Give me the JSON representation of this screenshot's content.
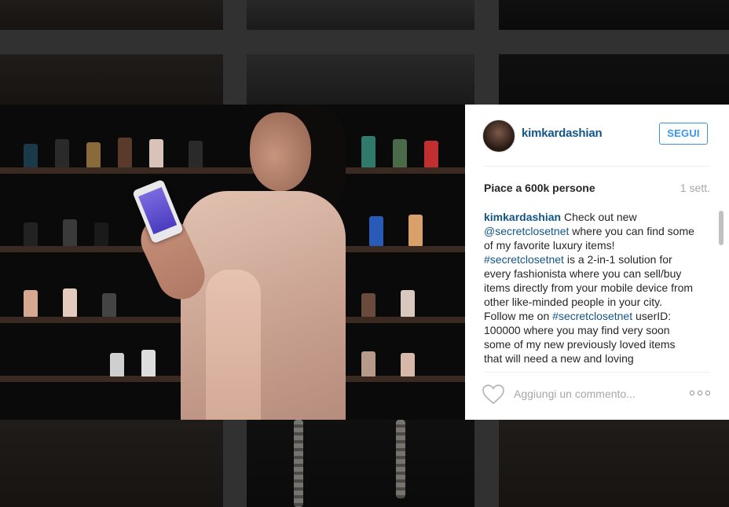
{
  "post": {
    "username": "kimkardashian",
    "follow_label": "SEGUI",
    "likes_text": "Piace a 600k persone",
    "time_text": "1 sett.",
    "caption": {
      "username": "kimkardashian",
      "parts": [
        " Check out new ",
        "@secretclosetnet",
        " where you can find some of my favorite luxury items! ",
        "#secretclosetnet",
        " is a 2-in-1 solution for every fashionista where you can sell/buy items directly from your mobile device from other like-minded people in your city. Follow me on ",
        "#secretclosetnet",
        " userID: 100000 where you may find very soon some of my new previously loved items that will need a new and loving"
      ]
    },
    "comment_placeholder": "Aggiungi un commento..."
  },
  "icons": {
    "avatar": "profile-avatar",
    "like": "heart-icon",
    "more": "more-options-icon"
  },
  "colors": {
    "link": "#125688",
    "follow_border": "#4090db",
    "muted": "#a5a7aa"
  }
}
